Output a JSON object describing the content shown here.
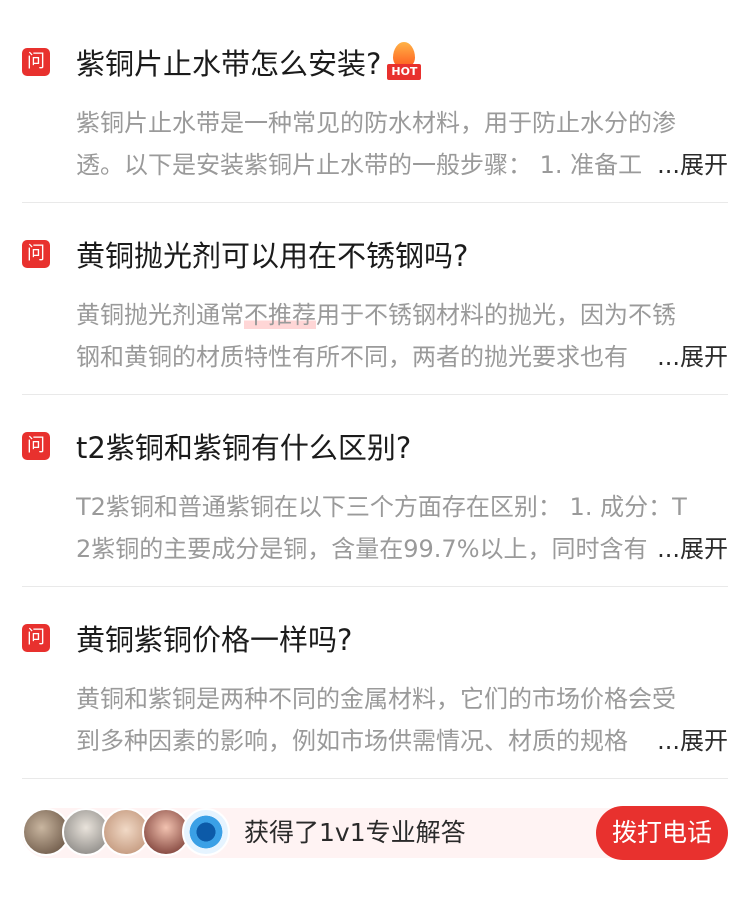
{
  "colors": {
    "accent": "#e8312e",
    "question_text": "#1b1b1b",
    "answer_text": "#9a9a9a"
  },
  "items": [
    {
      "q_badge": "问",
      "title": "紫铜片止水带怎么安装?",
      "hot_badge": "HOT",
      "answer_line1": "紫铜片止水带是一种常见的防水材料，用于防止水分的渗",
      "answer_line2": "透。以下是安装紫铜片止水带的一般步骤： 1. 准备工",
      "expand": "...展开"
    },
    {
      "q_badge": "问",
      "title": "黄铜抛光剂可以用在不锈钢吗?",
      "answer_line1_a": "黄铜抛光剂通常",
      "answer_line1_hl": "不推荐",
      "answer_line1_b": "用于不锈钢材料的抛光，因为不锈",
      "answer_line2": "钢和黄铜的材质特性有所不同，两者的抛光要求也有",
      "expand": "...展开"
    },
    {
      "q_badge": "问",
      "title": "t2紫铜和紫铜有什么区别?",
      "answer_line1": "T2紫铜和普通紫铜在以下三个方面存在区别： 1. 成分：T",
      "answer_line2": "2紫铜的主要成分是铜，含量在99.7%以上，同时含有",
      "expand": "...展开"
    },
    {
      "q_badge": "问",
      "title": "黄铜紫铜价格一样吗?",
      "answer_line1": "黄铜和紫铜是两种不同的金属材料，它们的市场价格会受",
      "answer_line2": "到多种因素的影响，例如市场供需情况、材质的规格",
      "expand": "...展开"
    }
  ],
  "bottom": {
    "consult_text": "获得了1v1专业解答",
    "call_button": "拨打电话"
  }
}
